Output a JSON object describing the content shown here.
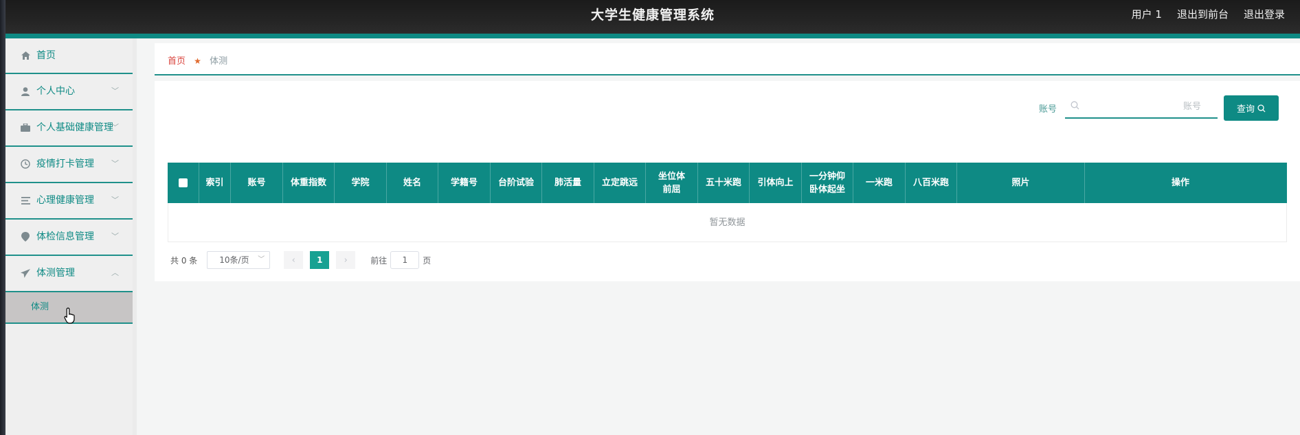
{
  "header": {
    "title": "大学生健康管理系统",
    "links": [
      "用户 1",
      "退出到前台",
      "退出登录"
    ]
  },
  "sidebar": {
    "items": [
      {
        "label": "首页",
        "icon": "home-icon"
      },
      {
        "label": "个人中心",
        "icon": "user-icon"
      },
      {
        "label": "个人基础健康管理",
        "icon": "briefcase-icon"
      },
      {
        "label": "疫情打卡管理",
        "icon": "clock-icon"
      },
      {
        "label": "心理健康管理",
        "icon": "list-icon"
      },
      {
        "label": "体检信息管理",
        "icon": "pin-icon"
      },
      {
        "label": "体测管理",
        "icon": "send-icon"
      }
    ],
    "subitem": "体测"
  },
  "breadcrumb": {
    "home": "首页",
    "current": "体测"
  },
  "search": {
    "label": "账号",
    "placeholder": "账号",
    "button": "查询"
  },
  "table": {
    "columns": [
      "索引",
      "账号",
      "体重指数",
      "学院",
      "姓名",
      "学籍号",
      "台阶试验",
      "肺活量",
      "立定跳远",
      "坐位体前屈",
      "五十米跑",
      "引体向上",
      "一分钟仰卧体起坐",
      "一米跑",
      "八百米跑",
      "照片",
      "操作"
    ],
    "empty_text": "暂无数据"
  },
  "pagination": {
    "total": "共 0 条",
    "page_size": "10条/页",
    "current_page": "1",
    "goto_label": "前往",
    "goto_value": "1",
    "page_suffix": "页"
  },
  "colors": {
    "accent": "#0e8a84",
    "active_page": "#16a192",
    "home_link": "#d9443d"
  }
}
